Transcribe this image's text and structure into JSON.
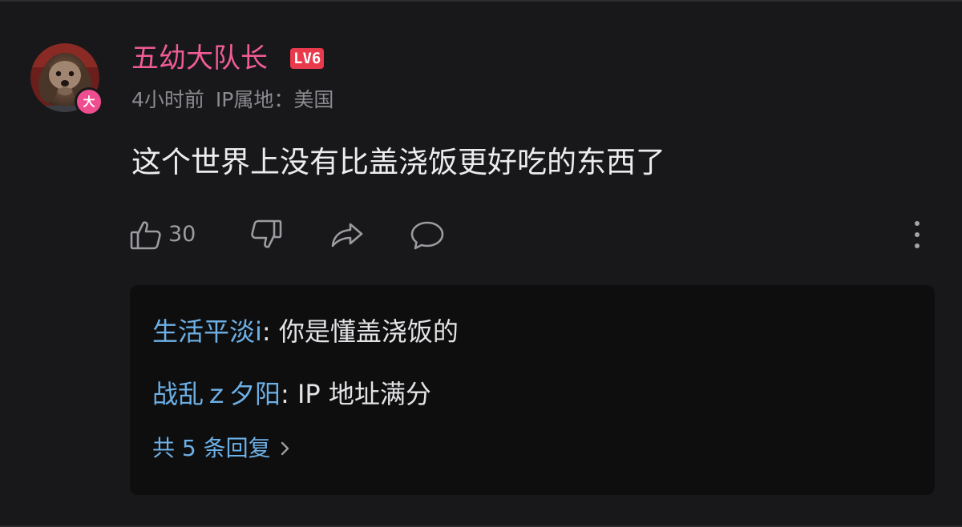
{
  "comment": {
    "username": "五幼大队长",
    "level": "LV6",
    "avatar_badge": "大",
    "time": "4小时前",
    "ip_location": "IP属地：美国",
    "text": "这个世界上没有比盖浇饭更好吃的东西了",
    "like_count": "30"
  },
  "icons": {
    "like": "thumbs-up-icon",
    "dislike": "thumbs-down-icon",
    "share": "share-arrow-icon",
    "reply": "speech-bubble-icon",
    "more": "vertical-ellipsis-icon",
    "chevron": "chevron-right-icon"
  },
  "replies": [
    {
      "user": "生活平淡i",
      "separator": ": ",
      "text": "你是懂盖浇饭的"
    },
    {
      "user": "战乱ｚ夕阳",
      "separator": ": ",
      "text": "IP 地址满分"
    }
  ],
  "more_replies_label": "共 5 条回复",
  "colors": {
    "background": "#18181a",
    "username": "#f05c96",
    "level_badge": "#e8394d",
    "reply_user": "#6db0e6",
    "reply_box": "#0e0e0f"
  }
}
